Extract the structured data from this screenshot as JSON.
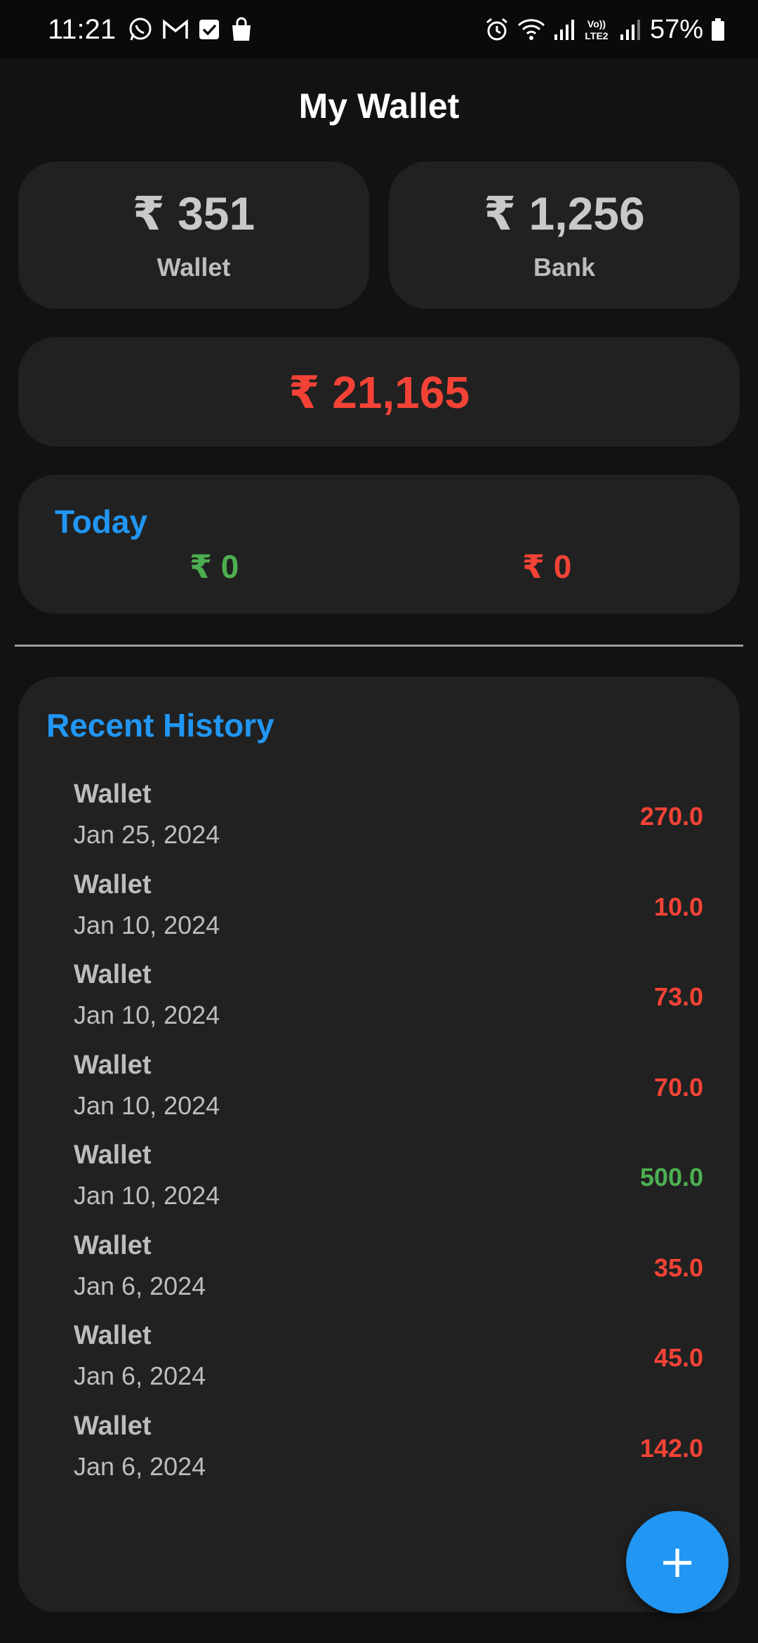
{
  "status_bar": {
    "time": "11:21",
    "left_icons": [
      "whatsapp-icon",
      "gmail-icon",
      "checkbox-app-icon",
      "shopping-bag-icon"
    ],
    "right_icons": [
      "alarm-icon",
      "wifi-icon",
      "signal-icon",
      "volte-icon",
      "signal-icon"
    ],
    "volte_label": "Vo)) LTE2",
    "battery_percent": "57%"
  },
  "header": {
    "title": "My Wallet"
  },
  "balances": {
    "wallet": {
      "amount": "₹ 351",
      "label": "Wallet"
    },
    "bank": {
      "amount": "₹ 1,256",
      "label": "Bank"
    }
  },
  "total": {
    "amount": "₹ 21,165"
  },
  "today": {
    "title": "Today",
    "income": "₹ 0",
    "expense": "₹ 0"
  },
  "history": {
    "title": "Recent History",
    "items": [
      {
        "account": "Wallet",
        "date": "Jan 25, 2024",
        "amount": "270.0",
        "type": "expense"
      },
      {
        "account": "Wallet",
        "date": "Jan 10, 2024",
        "amount": "10.0",
        "type": "expense"
      },
      {
        "account": "Wallet",
        "date": "Jan 10, 2024",
        "amount": "73.0",
        "type": "expense"
      },
      {
        "account": "Wallet",
        "date": "Jan 10, 2024",
        "amount": "70.0",
        "type": "expense"
      },
      {
        "account": "Wallet",
        "date": "Jan 10, 2024",
        "amount": "500.0",
        "type": "income"
      },
      {
        "account": "Wallet",
        "date": "Jan 6, 2024",
        "amount": "35.0",
        "type": "expense"
      },
      {
        "account": "Wallet",
        "date": "Jan 6, 2024",
        "amount": "45.0",
        "type": "expense"
      },
      {
        "account": "Wallet",
        "date": "Jan 6, 2024",
        "amount": "142.0",
        "type": "expense"
      }
    ]
  },
  "fab": {
    "icon": "plus-icon",
    "symbol": "+"
  },
  "colors": {
    "background": "#121212",
    "card": "#212121",
    "accent": "#2196f3",
    "expense": "#f44336",
    "income": "#4caf50"
  }
}
